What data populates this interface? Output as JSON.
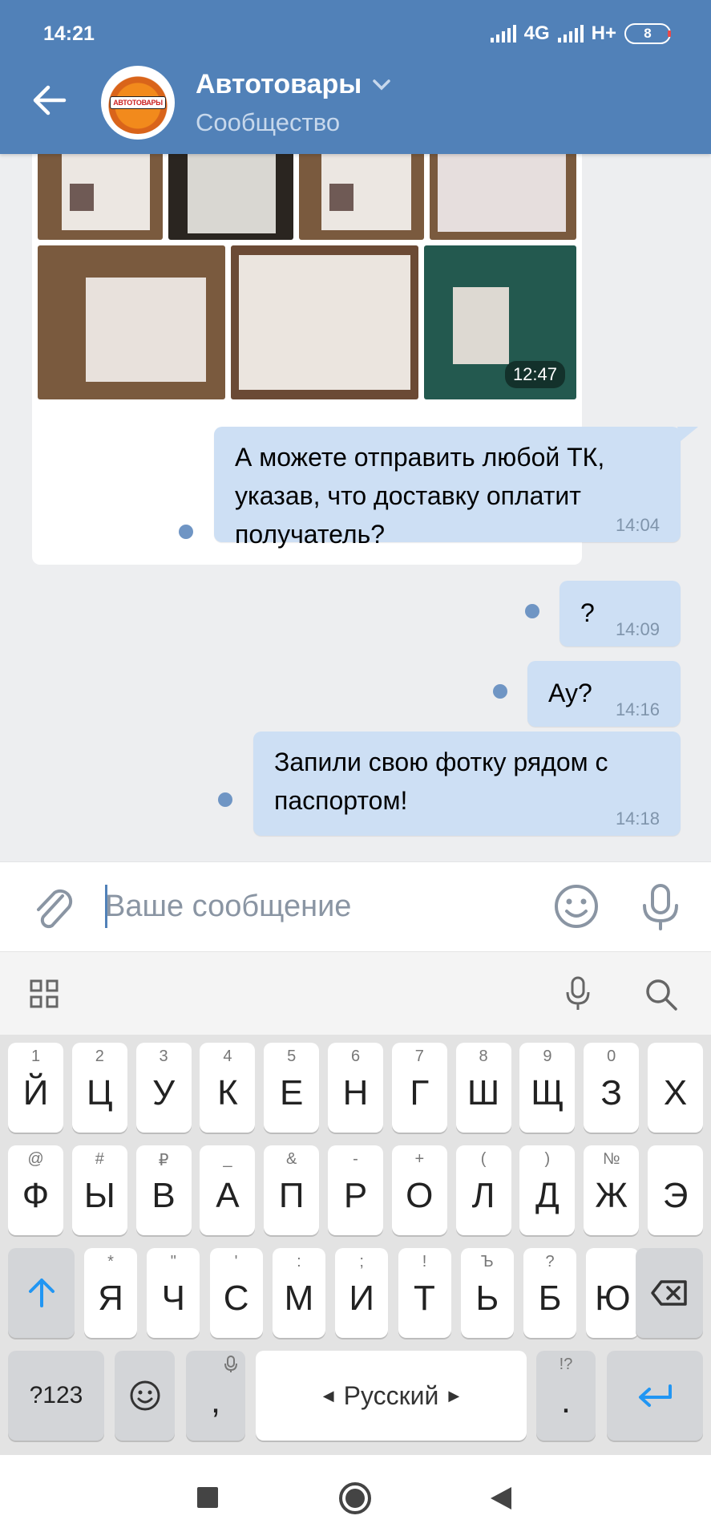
{
  "status_bar": {
    "time": "14:21",
    "network_1": "4G",
    "network_2": "H+",
    "battery": "8"
  },
  "header": {
    "title": "Автотовары",
    "subtitle": "Сообщество",
    "avatar_text": "АВТОТОВАРЫ"
  },
  "photos": {
    "timestamp": "12:47"
  },
  "messages": [
    {
      "lines": [
        "А можете отправить любой ТК,",
        "указав, что доставку оплатит",
        "получатель?"
      ],
      "time": "14:04"
    },
    {
      "lines": [
        "?"
      ],
      "time": "14:09"
    },
    {
      "lines": [
        "Ау?"
      ],
      "time": "14:16"
    },
    {
      "lines": [
        "Запили свою фотку рядом с",
        "паспортом!"
      ],
      "time": "14:18"
    }
  ],
  "composer": {
    "placeholder": "Ваше сообщение"
  },
  "keyboard": {
    "row1": [
      [
        "1",
        "Й"
      ],
      [
        "2",
        "Ц"
      ],
      [
        "3",
        "У"
      ],
      [
        "4",
        "К"
      ],
      [
        "5",
        "Е"
      ],
      [
        "6",
        "Н"
      ],
      [
        "7",
        "Г"
      ],
      [
        "8",
        "Ш"
      ],
      [
        "9",
        "Щ"
      ],
      [
        "0",
        "З"
      ],
      [
        "",
        "Х"
      ]
    ],
    "row2": [
      [
        "@",
        "Ф"
      ],
      [
        "#",
        "Ы"
      ],
      [
        "₽",
        "В"
      ],
      [
        "_",
        "А"
      ],
      [
        "&",
        "П"
      ],
      [
        "-",
        "Р"
      ],
      [
        "+",
        "О"
      ],
      [
        "(",
        "Л"
      ],
      [
        ")",
        "Д"
      ],
      [
        "№",
        "Ж"
      ],
      [
        "",
        "Э"
      ]
    ],
    "row3": [
      [
        "*",
        "Я"
      ],
      [
        "\"",
        "Ч"
      ],
      [
        "'",
        "С"
      ],
      [
        ":",
        "М"
      ],
      [
        ";",
        "И"
      ],
      [
        "!",
        "Т"
      ],
      [
        "Ъ",
        "Ь"
      ],
      [
        "?",
        "Б"
      ],
      [
        "",
        "Ю"
      ]
    ],
    "sym_key": "?123",
    "comma": ",",
    "space_label": "Русский",
    "period": ".",
    "period_hint": "!?"
  },
  "colors": {
    "header": "#5181b8",
    "bubble": "#cddff4",
    "accent": "#2196f3"
  }
}
